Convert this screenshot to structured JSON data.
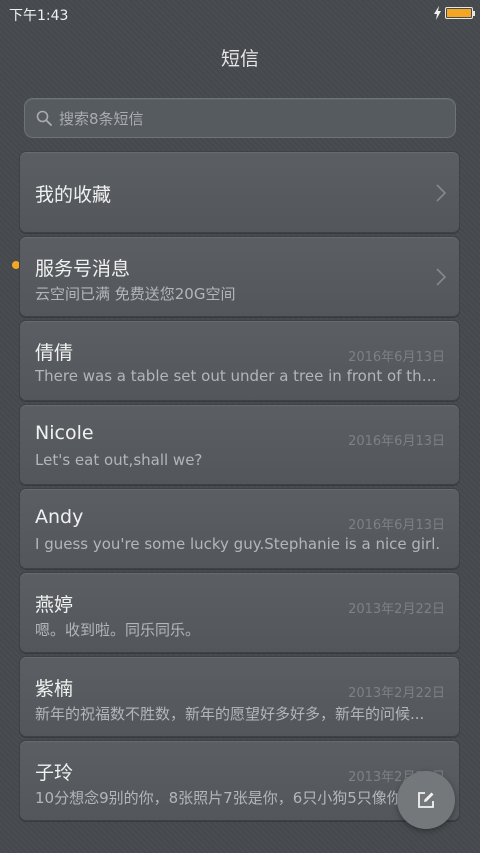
{
  "status": {
    "time": "下午1:43"
  },
  "header": {
    "title": "短信"
  },
  "search": {
    "placeholder": "搜索8条短信"
  },
  "favorites": {
    "label": "我的收藏"
  },
  "service": {
    "title": "服务号消息",
    "preview": "云空间已满 免费送您20G空间"
  },
  "conversations": [
    {
      "name": "倩倩",
      "date": "2016年6月13日",
      "preview": "There was a table set out under a tree in front of the h..."
    },
    {
      "name": "Nicole",
      "date": "2016年6月13日",
      "preview": "Let's eat out,shall we?"
    },
    {
      "name": "Andy",
      "date": "2016年6月13日",
      "preview": "I guess you're some lucky guy.Stephanie is a nice girl."
    },
    {
      "name": "燕婷",
      "date": "2013年2月22日",
      "preview": "嗯。收到啦。同乐同乐。"
    },
    {
      "name": "紫楠",
      "date": "2013年2月22日",
      "preview": "新年的祝福数不胜数，新年的愿望好多好多，新年的问候..."
    },
    {
      "name": "子玲",
      "date": "2013年2月22日",
      "preview": "10分想念9别的你，8张照片7张是你，6只小狗5只像你"
    }
  ],
  "icons": {
    "fab": "compose-icon",
    "chevron": "chevron-right-icon",
    "search": "search-icon"
  },
  "colors": {
    "accent": "#f5a623",
    "background": "#464a4e"
  }
}
